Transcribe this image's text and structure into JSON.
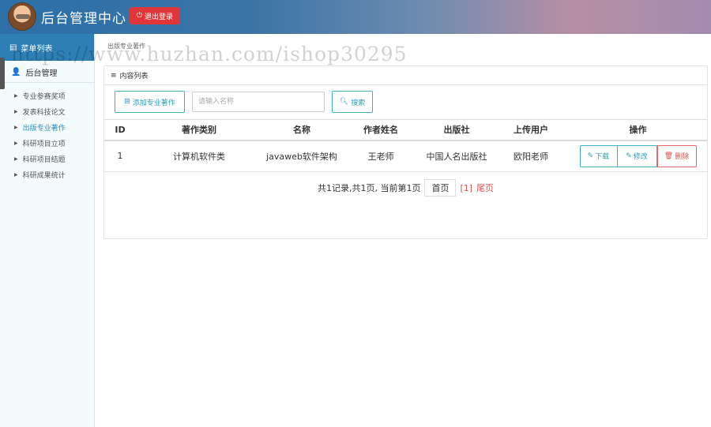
{
  "header": {
    "title": "后台管理中心",
    "logout_label": "退出登录"
  },
  "sidebar": {
    "menu_title": "菜单列表",
    "group_label": "后台管理",
    "items": [
      {
        "label": "专业参赛奖项",
        "active": false
      },
      {
        "label": "发表科技论文",
        "active": false
      },
      {
        "label": "出版专业著作",
        "active": true
      },
      {
        "label": "科研项目立项",
        "active": false
      },
      {
        "label": "科研项目结题",
        "active": false
      },
      {
        "label": "科研成果统计",
        "active": false
      }
    ]
  },
  "breadcrumb": "出版专业著作",
  "panel": {
    "title": "内容列表",
    "add_label": "添加专业著作",
    "search_placeholder": "请输入名称",
    "search_label": "搜索"
  },
  "table": {
    "headers": [
      "ID",
      "著作类别",
      "名称",
      "作者姓名",
      "出版社",
      "上传用户",
      "操作"
    ],
    "rows": [
      {
        "id": "1",
        "category": "计算机软件类",
        "name": "javaweb软件架构",
        "author": "王老师",
        "publisher": "中国人名出版社",
        "uploader": "欧阳老师"
      }
    ],
    "actions": {
      "download": "下载",
      "edit": "修改",
      "delete": "删除"
    }
  },
  "pager": {
    "summary": "共1记录,共1页, 当前第1页",
    "first": "首页",
    "current": "[1]",
    "last": "尾页"
  },
  "watermark": "https://www.huzhan.com/ishop30295",
  "colors": {
    "accent": "#2e9cb3",
    "danger": "#d9534f",
    "header_start": "#2d6fa8",
    "sidebar_head": "#2f7fb7"
  }
}
